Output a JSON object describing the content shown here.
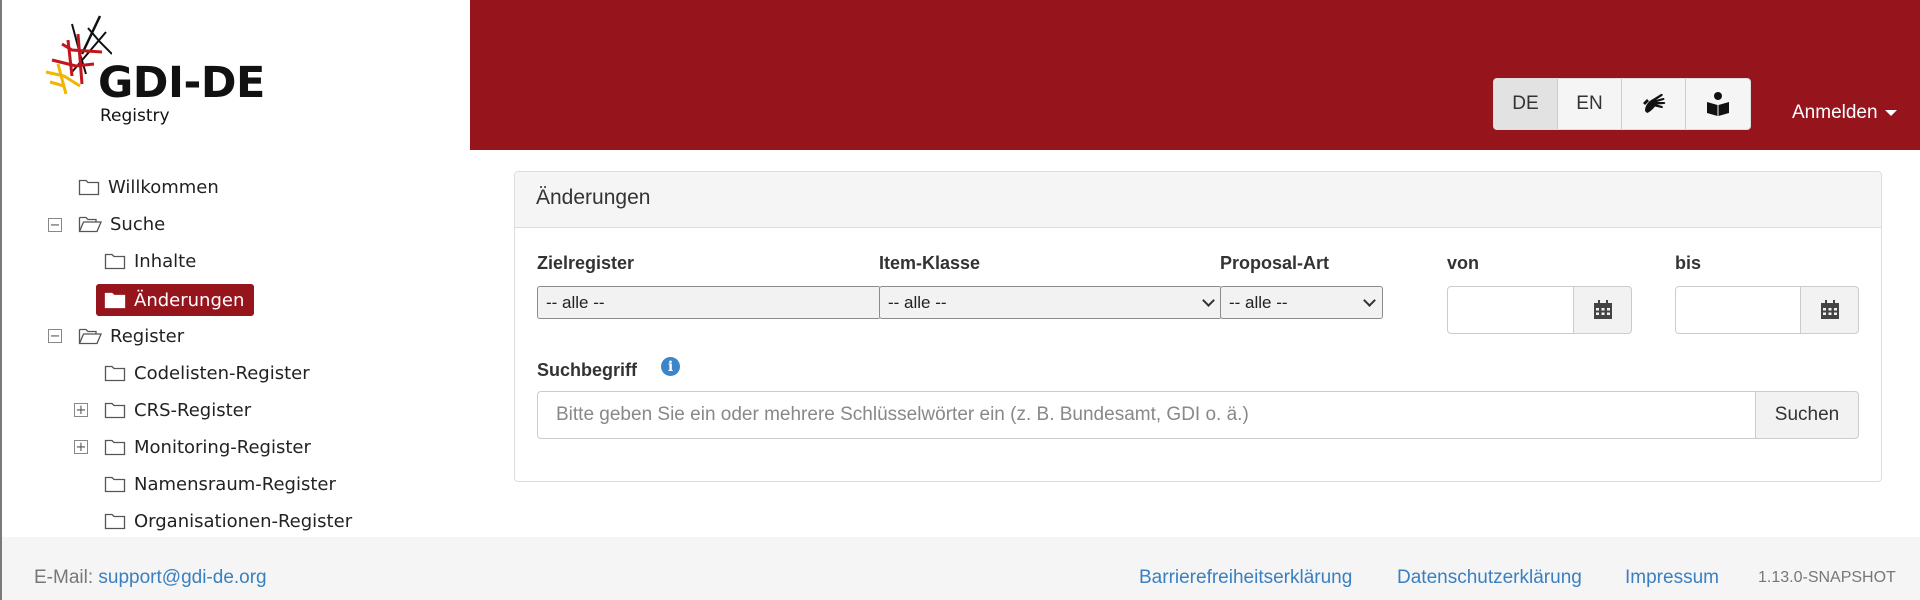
{
  "header": {
    "logo_text": "GDI-DE",
    "logo_subtitle": "Registry",
    "languages": [
      {
        "label": "DE",
        "active": true
      },
      {
        "label": "EN",
        "active": false
      }
    ],
    "access_icons": [
      "sign-language-icon",
      "easy-read-book-icon"
    ],
    "login_label": "Anmelden",
    "brand_color": "#96151d"
  },
  "sidebar": {
    "items": [
      {
        "label": "Willkommen",
        "level": 0,
        "toggle": null
      },
      {
        "label": "Suche",
        "level": 0,
        "toggle": "minus",
        "open": true
      },
      {
        "label": "Inhalte",
        "level": 1,
        "toggle": null
      },
      {
        "label": "Änderungen",
        "level": 1,
        "toggle": null,
        "selected": true
      },
      {
        "label": "Register",
        "level": 0,
        "toggle": "minus",
        "open": true
      },
      {
        "label": "Codelisten-Register",
        "level": 1,
        "toggle": null
      },
      {
        "label": "CRS-Register",
        "level": 1,
        "toggle": "plus"
      },
      {
        "label": "Monitoring-Register",
        "level": 1,
        "toggle": "plus"
      },
      {
        "label": "Namensraum-Register",
        "level": 1,
        "toggle": null
      },
      {
        "label": "Organisationen-Register",
        "level": 1,
        "toggle": null
      }
    ]
  },
  "panel": {
    "title": "Änderungen",
    "filters": {
      "zielregister": {
        "label": "Zielregister",
        "value": "-- alle --"
      },
      "item_klasse": {
        "label": "Item-Klasse",
        "value": "-- alle --"
      },
      "proposal_art": {
        "label": "Proposal-Art",
        "value": "-- alle --"
      },
      "von": {
        "label": "von",
        "value": ""
      },
      "bis": {
        "label": "bis",
        "value": ""
      }
    },
    "search": {
      "label": "Suchbegriff",
      "placeholder": "Bitte geben Sie ein oder mehrere Schlüsselwörter ein (z. B. Bundesamt, GDI o. ä.)",
      "button_label": "Suchen"
    }
  },
  "footer": {
    "email_label": "E-Mail:",
    "email": "support@gdi-de.org",
    "links": [
      "Barrierefreiheitserklärung",
      "Datenschutzerklärung",
      "Impressum"
    ],
    "version": "1.13.0-SNAPSHOT"
  }
}
